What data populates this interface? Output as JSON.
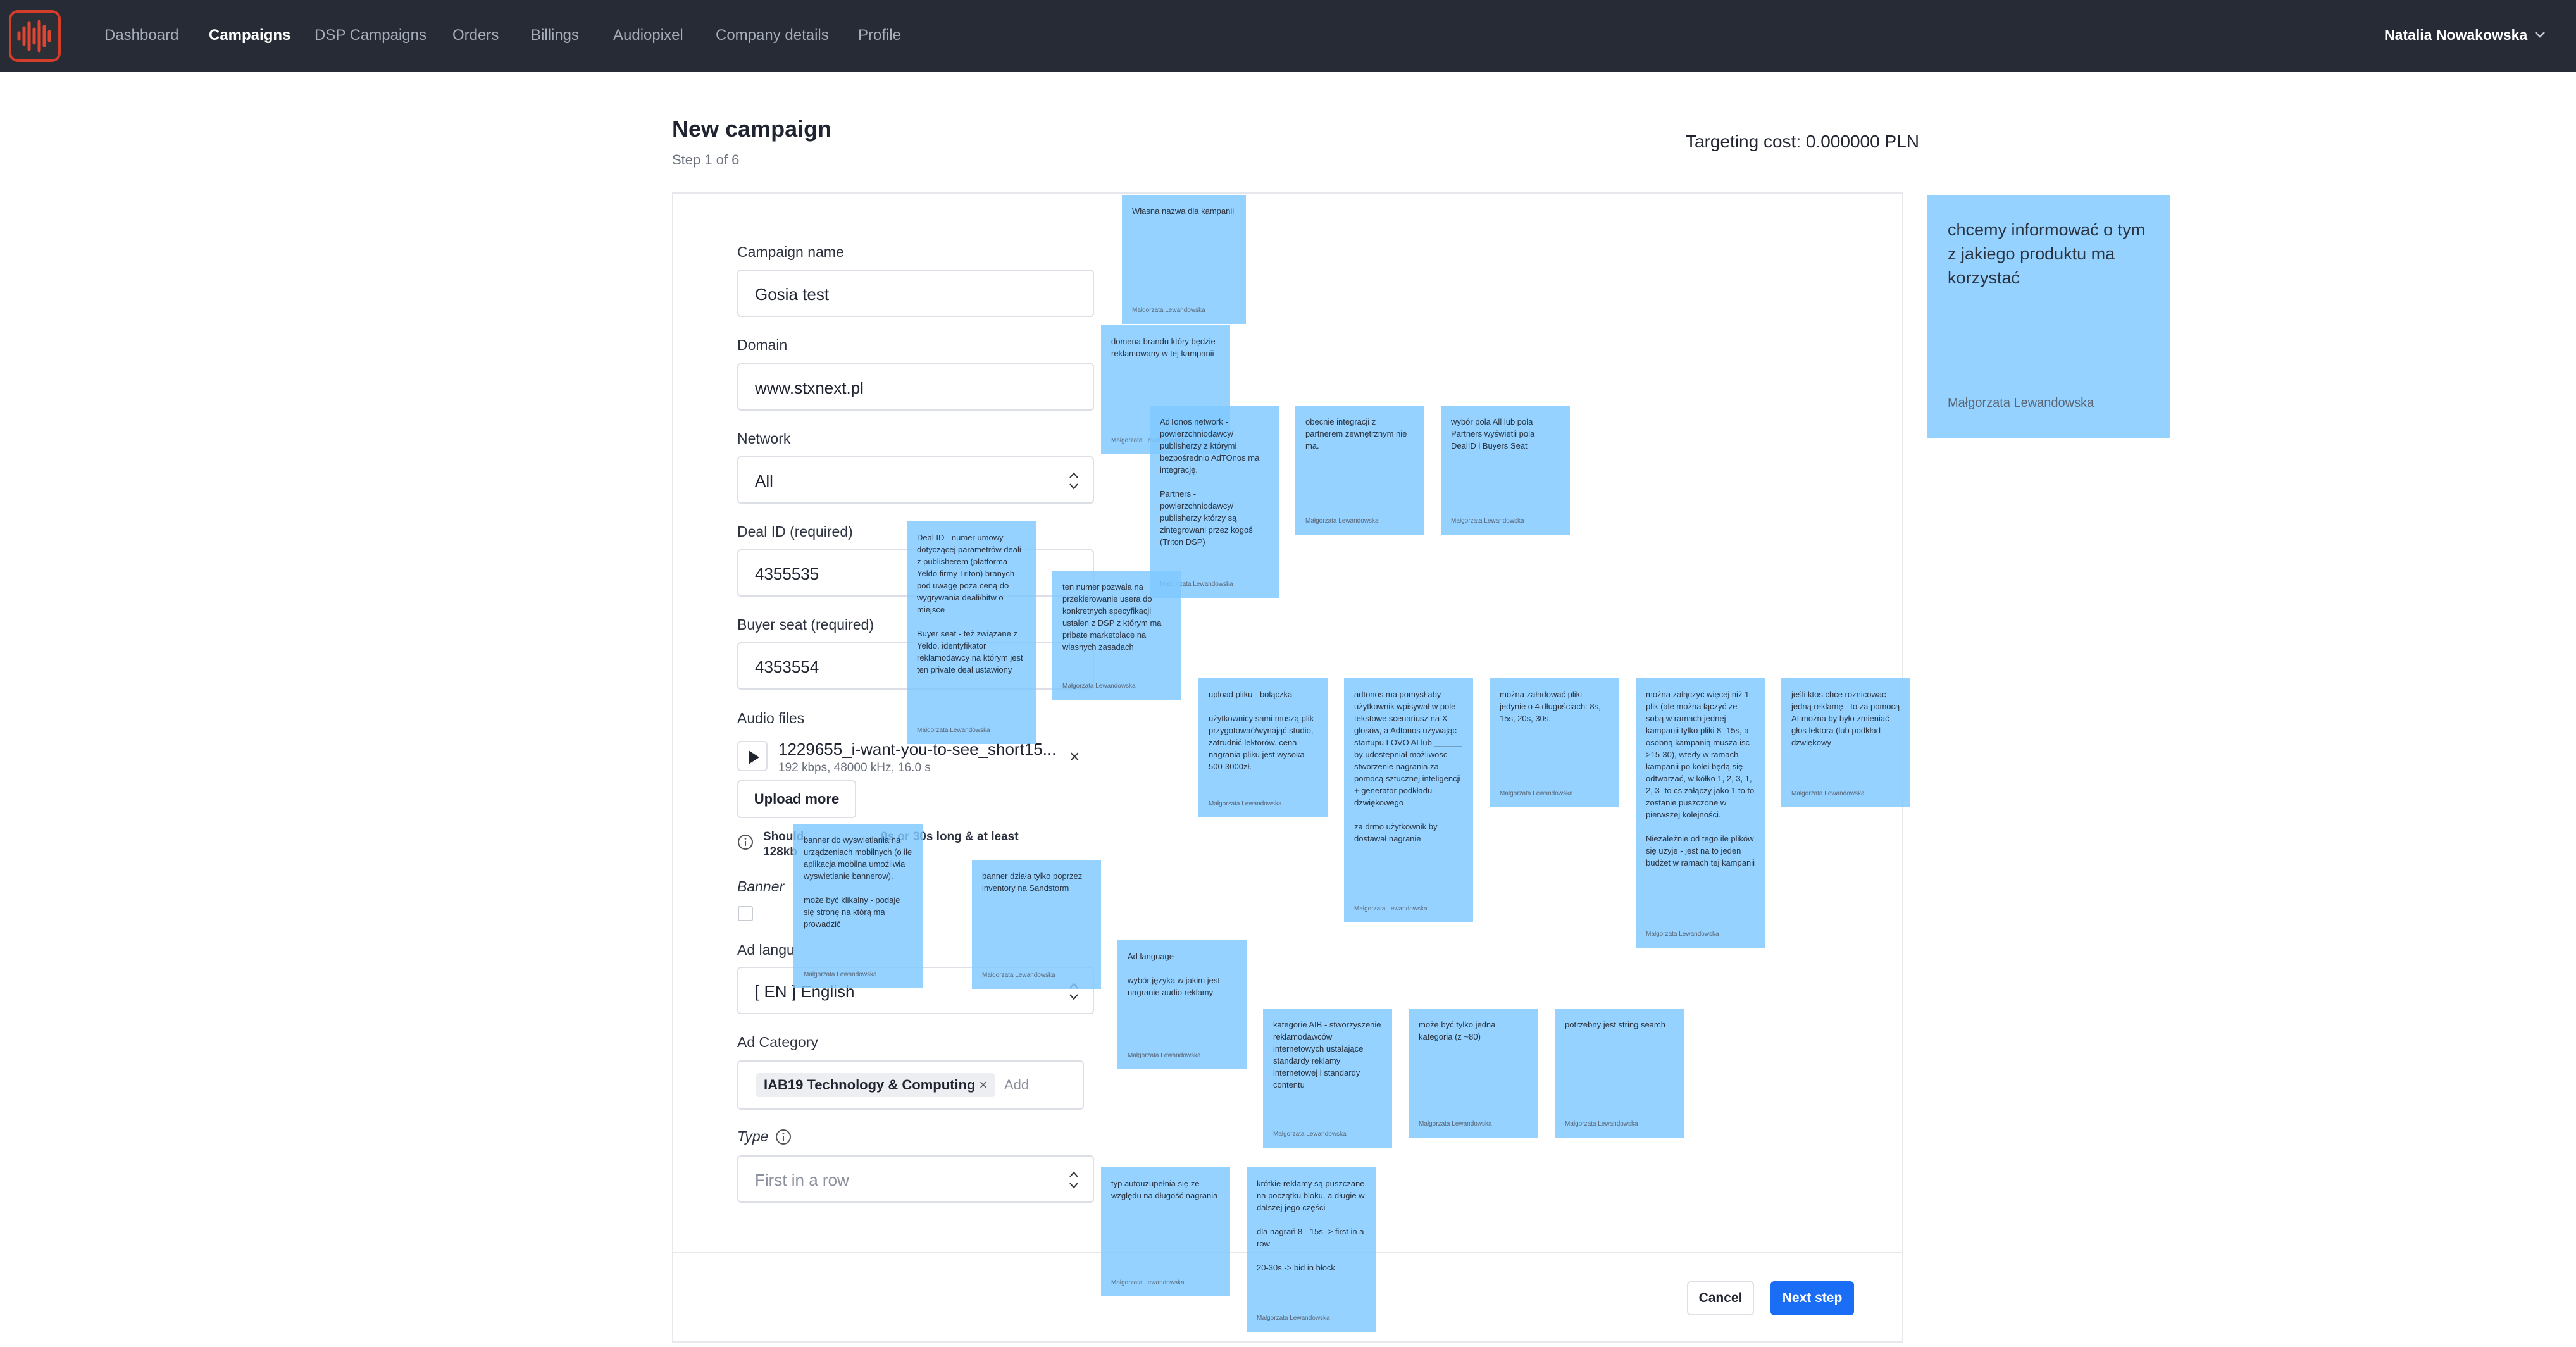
{
  "nav": {
    "items": [
      {
        "label": "Dashboard",
        "active": false
      },
      {
        "label": "Campaigns",
        "active": true
      },
      {
        "label": "DSP Campaigns",
        "active": false
      },
      {
        "label": "Orders",
        "active": false
      },
      {
        "label": "Billings",
        "active": false
      },
      {
        "label": "Audiopixel",
        "active": false
      },
      {
        "label": "Company details",
        "active": false
      },
      {
        "label": "Profile",
        "active": false
      }
    ],
    "user_name": "Natalia Nowakowska"
  },
  "header": {
    "title": "New campaign",
    "step": "Step 1 of 6",
    "targeting_cost": "Targeting cost: 0.000000 PLN"
  },
  "form": {
    "campaign_name": {
      "label": "Campaign name",
      "value": "Gosia test"
    },
    "domain": {
      "label": "Domain",
      "value": "www.stxnext.pl"
    },
    "network": {
      "label": "Network",
      "value": "All"
    },
    "deal_id": {
      "label": "Deal ID (required)",
      "value": "4355535"
    },
    "buyer_seat": {
      "label": "Buyer seat (required)",
      "value": "4353554"
    },
    "audio_files": {
      "label": "Audio files",
      "file_name": "1229655_i-want-you-to-see_short15...",
      "file_meta": "192 kbps, 48000 kHz, 16.0 s",
      "remove": "×",
      "upload_label": "Upload more",
      "hint_bold": "Should",
      "hint_line1_end": "0s or 30s long & at least",
      "hint_line2": "128kb"
    },
    "banner": {
      "label": "Banner"
    },
    "ad_language": {
      "label": "Ad langu",
      "value": "[ EN ] English"
    },
    "ad_category": {
      "label": "Ad Category",
      "tag": "IAB19 Technology & Computing",
      "tag_remove": "×",
      "add_placeholder": "Add"
    },
    "type": {
      "label": "Type",
      "placeholder": "First in a row"
    }
  },
  "footer": {
    "cancel": "Cancel",
    "next": "Next step"
  },
  "notes": [
    {
      "text": "Własna nazwa dla kampanii",
      "author": "Małgorzata Lewandowska"
    },
    {
      "text": "domena brandu który będzie reklamowany w tej kampanii",
      "author": "Małgorzata Lewandowska"
    },
    {
      "text": "AdTonos network - powierzchniodawcy/ publisherzy z którymi bezpośrednio AdTOnos ma integrację.\n\nPartners - powierzchniodawcy/ publisherzy którzy są zintegrowani przez kogoś (Triton DSP)",
      "author": "Małgorzata Lewandowska"
    },
    {
      "text": "obecnie integracji z partnerem zewnętrznym nie ma.",
      "author": "Małgorzata Lewandowska"
    },
    {
      "text": "wybór pola All lub pola Partners wyświetli pola DealID i Buyers Seat",
      "author": "Małgorzata Lewandowska"
    },
    {
      "text": "Deal ID - numer umowy dotyczącej parametrów deali z publisherem (platforma Yeldo firmy Triton) branych pod uwagę poza ceną do wygrywania deali/bitw o miejsce\n\nBuyer seat - też związane z Yeldo, identyfikator reklamodawcy na którym jest ten private deal ustawiony",
      "author": "Małgorzata Lewandowska"
    },
    {
      "text": "ten numer pozwala na przekierowanie usera do konkretnych specyfikacji ustalen z DSP z którym ma pribate marketplace na wlasnych zasadach",
      "author": "Małgorzata Lewandowska"
    },
    {
      "text": "upload pliku - bolączka\n\nużytkownicy sami muszą plik przygotować/wynająć studio, zatrudnić lektorów. cena nagrania pliku jest wysoka 500-3000zł.",
      "author": "Małgorzata Lewandowska"
    },
    {
      "text": "adtonos ma pomysł aby użytkownik wpisywał w pole tekstowe scenariusz na X głosów, a Adtonos używając startupu LOVO AI lub ______ by udostepniał możliwosc stworzenie nagrania za pomocą sztucznej inteligencji\n+ generator podkładu dzwiękowego\n\nza drmo użytkownik by dostawał nagranie",
      "author": "Małgorzata Lewandowska"
    },
    {
      "text": "można załadować pliki jedynie o 4 długościach: 8s, 15s, 20s, 30s.",
      "author": "Małgorzata Lewandowska"
    },
    {
      "text": "można załączyć więcej niż 1 plik (ale można łączyć ze sobą w ramach jednej kampanii tylko pliki 8 -15s, a osobną kampanią musza isc >15-30), wtedy w ramach kampanii po kolei będą się odtwarzać, w kółko 1, 2, 3, 1, 2, 3 -to cs załączy jako 1 to to zostanie puszczone w pierwszej kolejności.\n\nNiezależnie od tego ile plików się użyje - jest na to jeden budżet w ramach tej kampanii",
      "author": "Małgorzata Lewandowska"
    },
    {
      "text": "jeśli ktos chce roznicowac jedną reklamę - to za pomocą AI można by było zmieniać głos lektora (lub podkład dzwiękowy",
      "author": "Małgorzata Lewandowska"
    },
    {
      "text": "banner do wyswietlania na urządzeniach mobilnych (o ile aplikacja mobilna umożliwia wyswietlanie bannerow).\n\nmoże być klikalny - podaje się stronę na którą ma prowadzić",
      "author": "Małgorzata Lewandowska"
    },
    {
      "text": "banner działa tylko poprzez inventory na Sandstorm",
      "author": "Małgorzata Lewandowska"
    },
    {
      "text": "Ad language\n\nwybór języka w jakim jest nagranie audio reklamy",
      "author": "Małgorzata Lewandowska"
    },
    {
      "text": "kategorie AIB - stworzyszenie reklamodawców internetowych ustalające standardy reklamy internetowej i standardy contentu",
      "author": "Małgorzata Lewandowska"
    },
    {
      "text": "może być tylko jedna kategoria (z ~80)",
      "author": "Małgorzata Lewandowska"
    },
    {
      "text": "potrzebny jest string search",
      "author": "Małgorzata Lewandowska"
    },
    {
      "text": "typ autouzupełnia się ze względu na długość nagrania",
      "author": "Małgorzata Lewandowska"
    },
    {
      "text": "krótkie reklamy są puszczane na początku bloku, a długie w dalszej jego części\n\ndla nagrań 8 - 15s -> first in a row\n\n20-30s -> bid in block",
      "author": "Małgorzata Lewandowska"
    },
    {
      "text": "chcemy informować o tym z jakiego produktu ma korzystać",
      "author": "Małgorzata Lewandowska"
    }
  ],
  "colors": {
    "navbar": "#262b36",
    "primary": "#1a6ef5",
    "note": "#7ec8ff",
    "logo_accent": "#d43d2a"
  }
}
